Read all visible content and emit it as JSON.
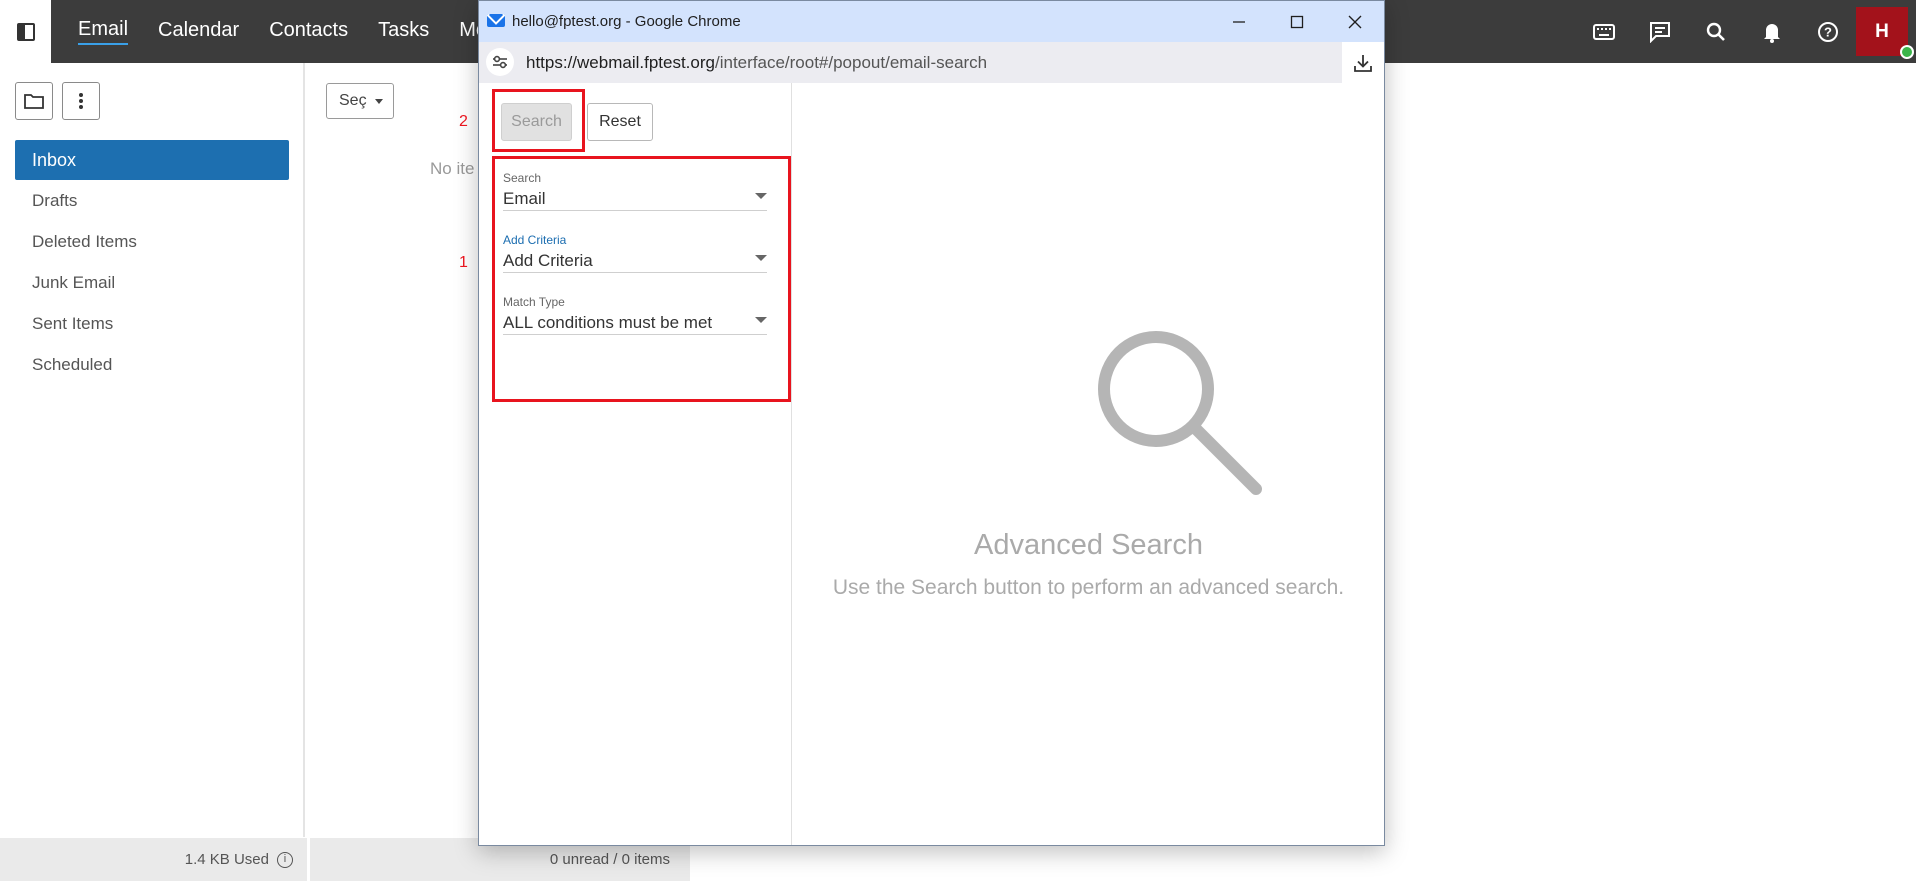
{
  "topbar": {
    "nav": [
      "Email",
      "Calendar",
      "Contacts",
      "Tasks",
      "Mo"
    ],
    "active_nav": "Email",
    "icons": [
      "keyboard-icon",
      "chat-icon",
      "search-icon",
      "bell-icon",
      "help-icon"
    ],
    "avatar_initial": "H",
    "avatar_color": "#a3121b",
    "presence_color": "#3bb54a"
  },
  "folders": {
    "items": [
      "Inbox",
      "Drafts",
      "Deleted Items",
      "Junk Email",
      "Sent Items",
      "Scheduled"
    ],
    "selected": "Inbox",
    "selected_color": "#1d6fb0"
  },
  "list": {
    "select_label": "Seç",
    "empty_text": "No ite"
  },
  "status": {
    "storage": "1.4 KB Used",
    "counts": "0 unread / 0 items"
  },
  "popup": {
    "window_title": "hello@fptest.org - Google Chrome",
    "url_host": "https://webmail.fptest.org",
    "url_path": "/interface/root#/popout/email-search",
    "search_button": "Search",
    "reset_button": "Reset",
    "marker_1": "1",
    "marker_2": "2",
    "fields": {
      "search": {
        "label": "Search",
        "value": "Email"
      },
      "criteria": {
        "label": "Add Criteria",
        "value": "Add Criteria"
      },
      "match": {
        "label": "Match Type",
        "value": "ALL conditions must be met"
      }
    },
    "empty_title": "Advanced Search",
    "empty_subtitle": "Use the Search button to perform an advanced search.",
    "highlight_color": "#e8141e"
  }
}
